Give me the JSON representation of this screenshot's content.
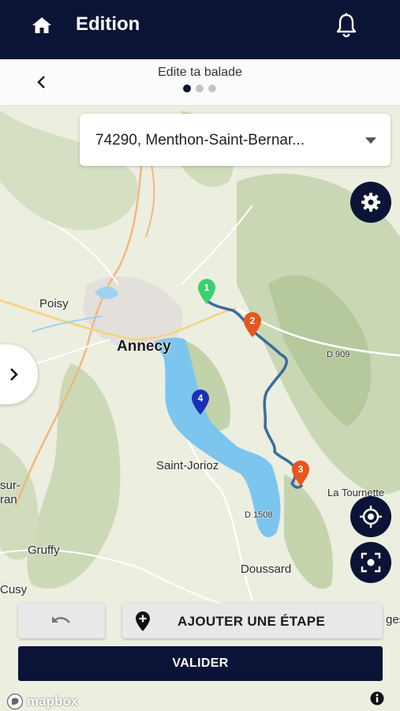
{
  "header": {
    "title": "Edition",
    "home_icon": "home-icon",
    "bell_icon": "bell-icon",
    "background": "#0b1436"
  },
  "subheader": {
    "title": "Edite ta balade",
    "steps_total": 3,
    "step_active": 1
  },
  "location_select": {
    "value": "74290, Menthon-Saint-Bernar..."
  },
  "map": {
    "labels": {
      "annecy": "Annecy",
      "poisy": "Poisy",
      "saint_jorioz": "Saint-Jorioz",
      "gruffy": "Gruffy",
      "doussard": "Doussard",
      "la_tournette": "La Tournette",
      "cusy": "Cusy",
      "sur": "sur-",
      "ran": "ran",
      "ges": "ges",
      "d909": "D 909",
      "d1508": "D 1508"
    },
    "markers": [
      {
        "number": "1",
        "color": "#3ccf6e"
      },
      {
        "number": "2",
        "color": "#e8561f"
      },
      {
        "number": "3",
        "color": "#e8561f"
      },
      {
        "number": "4",
        "color": "#1d2fb8"
      }
    ],
    "route_color": "#3b6c9e",
    "lake_color": "#7cc5ef"
  },
  "actions": {
    "undo_icon": "undo-icon",
    "add_step_label": "AJOUTER UNE ÉTAPE",
    "validate_label": "VALIDER"
  },
  "attribution": {
    "logo_text": "mapbox"
  }
}
